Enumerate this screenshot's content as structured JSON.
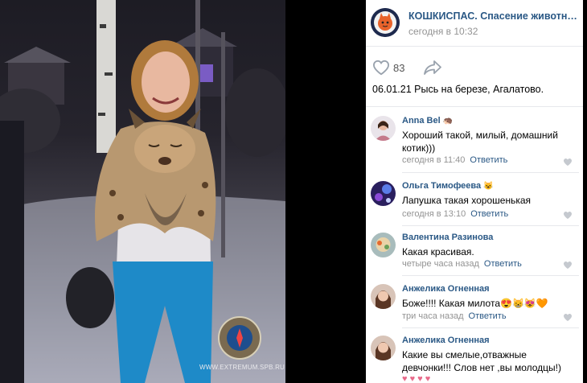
{
  "photo": {
    "watermark": "WWW.EXTREMUM.SPB.RU",
    "alt_icon": "photo-of-woman-holding-lynx"
  },
  "group": {
    "name": "КОШКИСПАС. Спасение животных",
    "time": "сегодня в 10:32",
    "avatar_icon": "cat-logo-icon"
  },
  "post": {
    "likes": "83",
    "caption": "06.01.21 Рысь на березе, Агалатово."
  },
  "comments": [
    {
      "author": "Anna Bel",
      "author_emoji": "🦔",
      "text": "Хороший такой, милый, домашний котик)))",
      "time": "сегодня в 11:40",
      "reply": "Ответить",
      "avatar_color": "#c47a8b"
    },
    {
      "author": "Ольга Тимофеева",
      "author_emoji": "😺",
      "text": "Лапушка такая хорошенькая",
      "time": "сегодня в 13:10",
      "reply": "Ответить",
      "avatar_color": "#3a2a6e"
    },
    {
      "author": "Валентина Разинова",
      "author_emoji": "",
      "text": "Какая красивая.",
      "time": "четыре часа назад",
      "reply": "Ответить",
      "avatar_color": "#8aa6a8"
    },
    {
      "author": "Анжелика Огненная",
      "author_emoji": "",
      "text": "Боже!!!! Какая милота😍😸😻🧡",
      "time": "три часа назад",
      "reply": "Ответить",
      "avatar_color": "#8a5a3c"
    },
    {
      "author": "Анжелика Огненная",
      "author_emoji": "",
      "text": "Какие вы смелые,отважные девчонки!!! Слов нет ,вы молодцы!)",
      "time": "",
      "reply": "",
      "avatar_color": "#8a5a3c"
    }
  ],
  "colors": {
    "link": "#2a5885",
    "meta": "#939393",
    "divider": "#e7e8ec"
  }
}
